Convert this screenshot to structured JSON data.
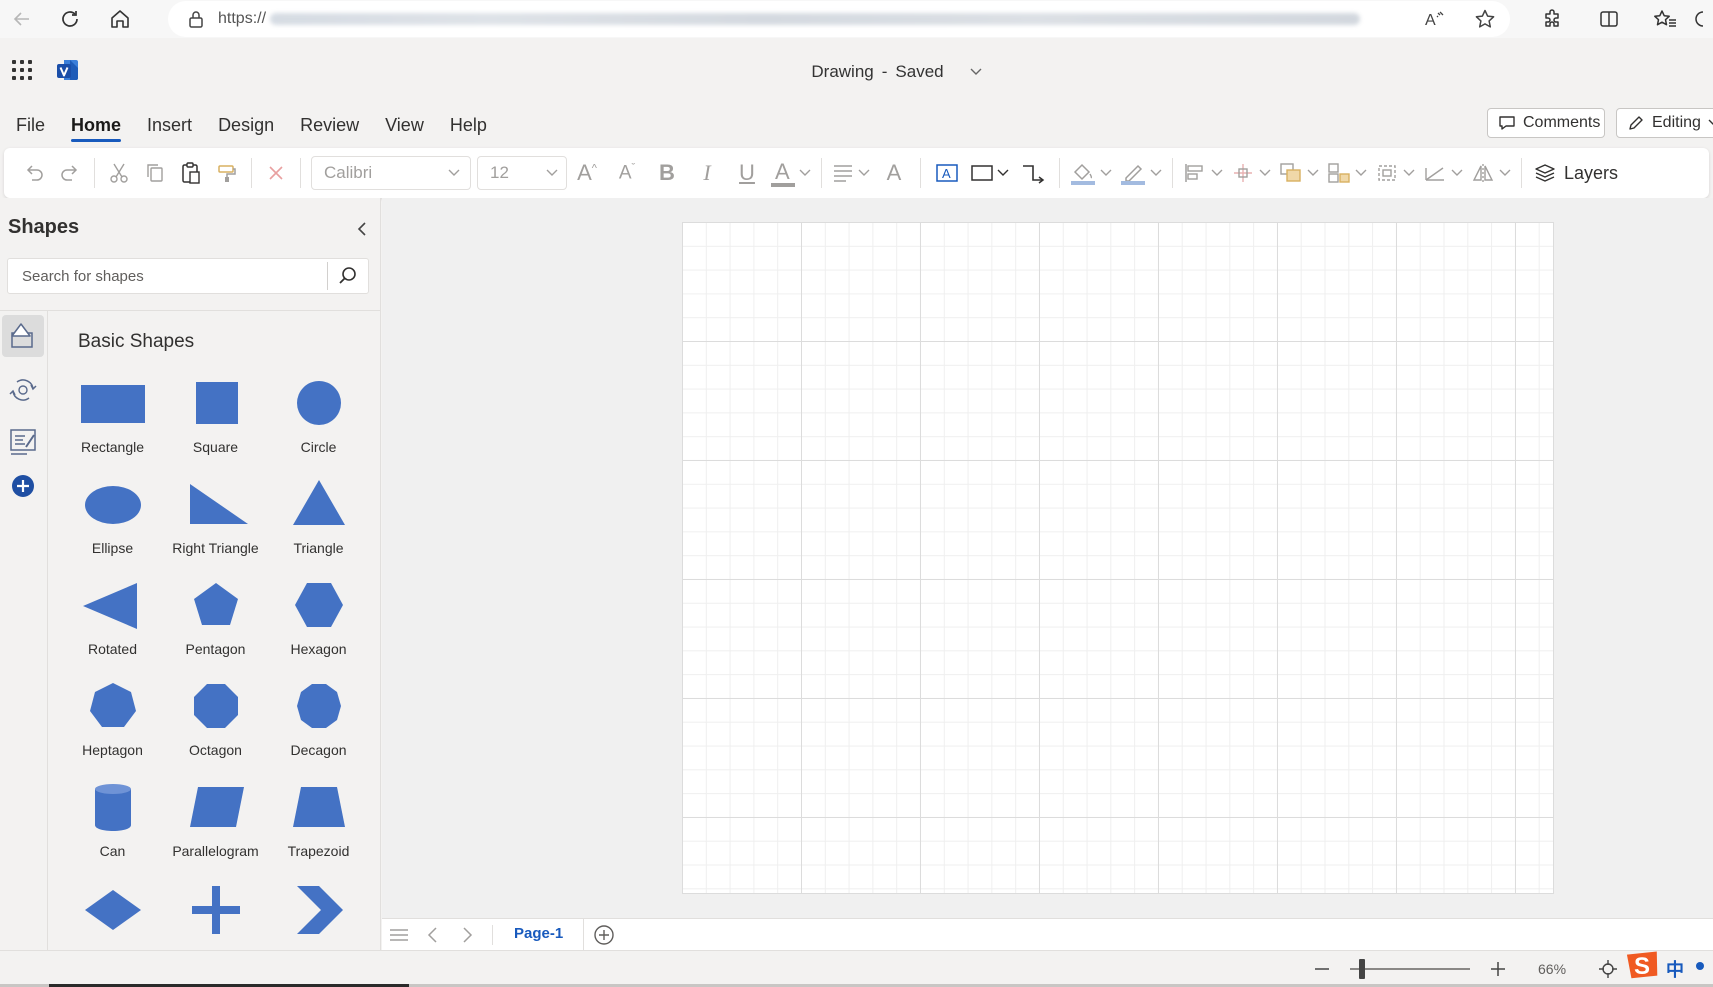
{
  "browser": {
    "url_scheme": "https://",
    "read_aloud_label": "A"
  },
  "app": {
    "title": "Drawing",
    "separator": "-",
    "save_status": "Saved"
  },
  "menu": {
    "tabs": [
      "File",
      "Home",
      "Insert",
      "Design",
      "Review",
      "View",
      "Help"
    ],
    "active": "Home"
  },
  "header_buttons": {
    "comments": "Comments",
    "editing": "Editing"
  },
  "ribbon": {
    "font_name": "Calibri",
    "font_size": "12",
    "grow_font": "A",
    "shrink_font": "A",
    "bold": "B",
    "italic": "I",
    "underline": "U",
    "font_color": "A",
    "text_size": "A",
    "layers": "Layers"
  },
  "shapes_panel": {
    "title": "Shapes",
    "search_placeholder": "Search for shapes",
    "stencil_title": "Basic Shapes",
    "shapes": [
      {
        "label": "Rectangle",
        "icon": "rectangle"
      },
      {
        "label": "Square",
        "icon": "square"
      },
      {
        "label": "Circle",
        "icon": "circle"
      },
      {
        "label": "Ellipse",
        "icon": "ellipse"
      },
      {
        "label": "Right Triangle",
        "icon": "right-triangle"
      },
      {
        "label": "Triangle",
        "icon": "triangle"
      },
      {
        "label": "Rotated",
        "icon": "rotated-triangle"
      },
      {
        "label": "Pentagon",
        "icon": "pentagon"
      },
      {
        "label": "Hexagon",
        "icon": "hexagon"
      },
      {
        "label": "Heptagon",
        "icon": "heptagon"
      },
      {
        "label": "Octagon",
        "icon": "octagon"
      },
      {
        "label": "Decagon",
        "icon": "decagon"
      },
      {
        "label": "Can",
        "icon": "can"
      },
      {
        "label": "Parallelogram",
        "icon": "parallelogram"
      },
      {
        "label": "Trapezoid",
        "icon": "trapezoid"
      },
      {
        "label": "",
        "icon": "diamond"
      },
      {
        "label": "",
        "icon": "cross"
      },
      {
        "label": "",
        "icon": "chevron"
      }
    ],
    "shape_color": "#4472c4"
  },
  "page_tabs": {
    "pages": [
      "Page-1"
    ],
    "active": "Page-1"
  },
  "status": {
    "zoom_level": "66%",
    "zoom_fraction": 0.1,
    "ime_label": "中"
  },
  "colors": {
    "accent": "#185abd",
    "shape_fill": "#4472c4",
    "ime_orange": "#f05a22"
  }
}
